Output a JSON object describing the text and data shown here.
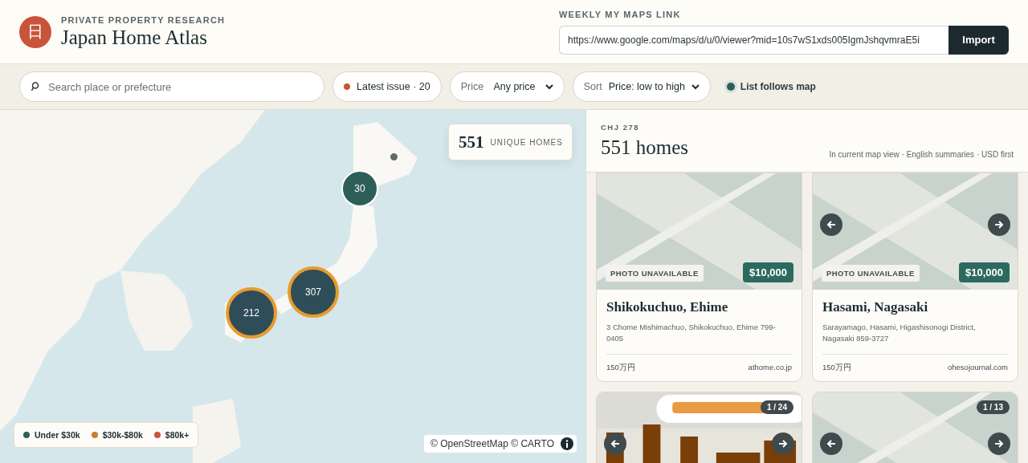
{
  "header": {
    "logo_glyph": "日",
    "eyebrow": "PRIVATE PROPERTY RESEARCH",
    "title": "Japan Home Atlas"
  },
  "import": {
    "label": "WEEKLY MY MAPS LINK",
    "value": "https://www.google.com/maps/d/u/0/viewer?mid=10s7wS1xds005IgmJshqvmraE5i",
    "button": "Import"
  },
  "filters": {
    "search": {
      "placeholder": "Search place or prefecture"
    },
    "issue": {
      "label": "Latest issue · 20",
      "color": "#c8553a"
    },
    "price": {
      "label": "Price",
      "value": "Any price"
    },
    "sort": {
      "label": "Sort",
      "value": "Price: low to high"
    },
    "follow": {
      "label": "List follows map",
      "on": true
    }
  },
  "map": {
    "stats": {
      "count": "551",
      "label": "UNIQUE HOMES"
    },
    "markers": [
      {
        "kind": "point"
      },
      {
        "kind": "cluster",
        "count": "30"
      },
      {
        "kind": "ringed",
        "count": "307"
      },
      {
        "kind": "ringed",
        "count": "212"
      }
    ],
    "legend": [
      {
        "label": "Under $30k",
        "color": "#2d5e57"
      },
      {
        "label": "$30k-$80k",
        "color": "#c97d35"
      },
      {
        "label": "$80k+",
        "color": "#c8553a"
      }
    ],
    "attribution": "© OpenStreetMap © CARTO"
  },
  "list": {
    "code": "CHJ 278",
    "title": "551 homes",
    "subtitle": "In current map view · English summaries · USD first",
    "cards": [
      {
        "kind": "placeholder",
        "badge": "PHOTO UNAVAILABLE",
        "price": "$10,000",
        "arrows": false,
        "title": "Shikokuchuo, Ehime",
        "address": "3 Chome Mishimachuo, Shikokuchuo, Ehime 799-0405",
        "price_jpy": "150万円",
        "source": "athome.co.jp"
      },
      {
        "kind": "placeholder",
        "badge": "PHOTO UNAVAILABLE",
        "price": "$10,000",
        "arrows": true,
        "title": "Hasami, Nagasaki",
        "address": "Sarayamago, Hasami, Higashisonogi District, Nagasaki 859-3727",
        "price_jpy": "150万円",
        "source": "ohesojournal.com"
      },
      {
        "kind": "picture",
        "counter": "1 / 24",
        "arrows": true
      },
      {
        "kind": "placeholder",
        "counter": "1 / 13",
        "arrows": true
      }
    ]
  }
}
